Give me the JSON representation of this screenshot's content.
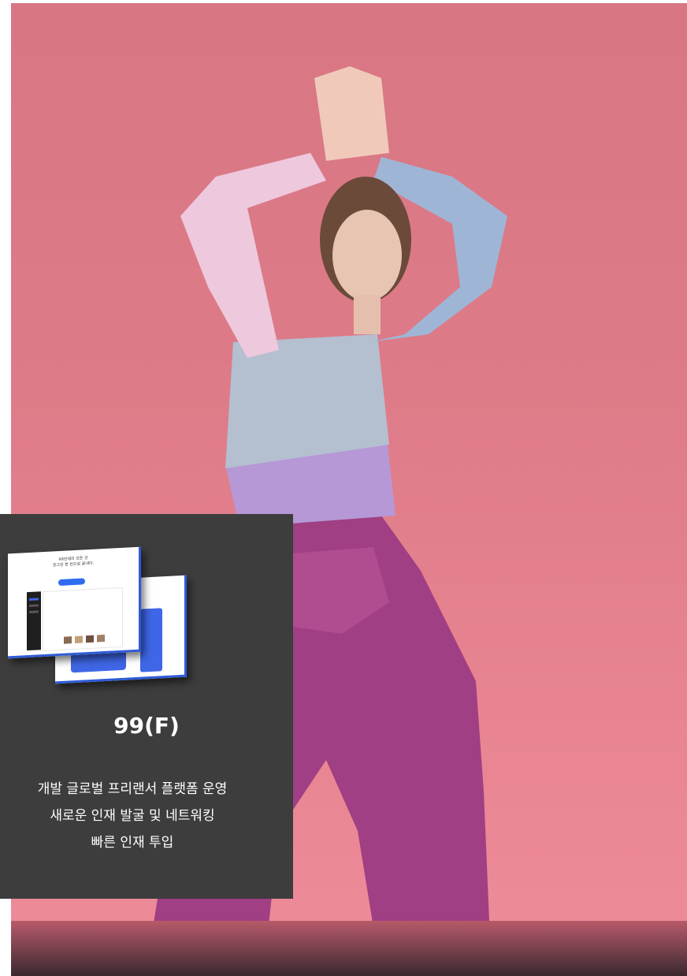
{
  "photo": {
    "background_color": "#de7b88"
  },
  "card": {
    "background_color": "#3d3d3d",
    "title": "99(F)",
    "lines": [
      "개발 글로벌 프리랜서 플랫폼 운영",
      "새로운 인재 발굴 및 네트워킹",
      "빠른 인재 투입"
    ],
    "mockup": {
      "headline_line1": "99인재의 모든 것",
      "headline_line2": "로그인 한 번으로 끝내다."
    }
  }
}
